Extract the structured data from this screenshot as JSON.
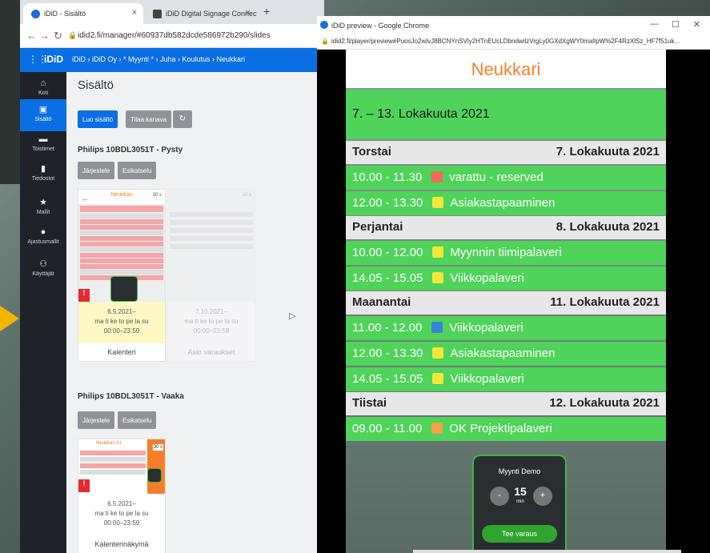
{
  "browser1": {
    "tabs": [
      {
        "label": "iDiD - Sisältö",
        "close": "×"
      },
      {
        "label": "iDiD Digital Signage Connector f",
        "close": "×"
      }
    ],
    "new_tab": "+",
    "url": "idid2.fi/manager/#60937db582dcde586972b290/slides"
  },
  "app": {
    "logo": "iDiD",
    "breadcrumb": "iDiD › iDiD Oy › * Myynti * › Juha › Koulutus › Neukkari",
    "sidebar": [
      {
        "icon": "home-icon",
        "glyph": "⌂",
        "label": "Koti"
      },
      {
        "icon": "image-icon",
        "glyph": "▣",
        "label": "Sisältö"
      },
      {
        "icon": "monitor-icon",
        "glyph": "▬",
        "label": "Toistimet"
      },
      {
        "icon": "file-icon",
        "glyph": "▮",
        "label": "Tiedostot"
      },
      {
        "icon": "star-icon",
        "glyph": "★",
        "label": "Mallit"
      },
      {
        "icon": "clock-icon",
        "glyph": "●",
        "label": "Ajastusmallit"
      },
      {
        "icon": "users-icon",
        "glyph": "⚇",
        "label": "Käyttäjät"
      }
    ],
    "page_title": "Sisältö",
    "create_button": "Luo sisältö",
    "order_channel_button": "Tilaa kanava",
    "refresh_icon": "refresh-icon",
    "sections": [
      {
        "title": "Philips 10BDL3051T - Pysty",
        "arrange_button": "Järjestele",
        "preview_button": "Esikatselu",
        "cards": [
          {
            "thumb_title": "Neukkari",
            "duration": "30 s",
            "dates": "6.5.2021–",
            "days": "ma ti ke to pe la su",
            "time": "00:00–23:59",
            "name": "Kalenteri"
          },
          {
            "thumb_title": "",
            "duration": "30 s",
            "dates": "7.10.2021–",
            "days": "ma ti ke to pe la su",
            "time": "00:00–23:59",
            "name": "Asio varaukset"
          }
        ]
      },
      {
        "title": "Philips 10BDL3051T - Vaaka",
        "arrange_button": "Järjestele",
        "preview_button": "Esikatselu",
        "cards": [
          {
            "thumb_title": "Neukkari A1",
            "duration": "30 s",
            "dates": "6.5.2021–",
            "days": "ma ti ke to pe la su",
            "time": "00:00–23:59",
            "name": "Kalenterinäkymä"
          }
        ]
      }
    ]
  },
  "browser2": {
    "title": "iDiD preview - Google Chrome",
    "url": "idid2.fi/player/preview#PuosJo2wlvJ8BCNYnSVly2HTnEUcLDbndwilzVrgLy0GXdXgWY0malIpW%2F4RzXlSz_HF7f51uk..."
  },
  "calendar": {
    "room": "Neukkari",
    "week": "7. – 13. Lokakuuta 2021",
    "days": [
      {
        "day": "Torstai",
        "date": "7. Lokakuuta 2021",
        "events": [
          {
            "time": "10.00 - 11.30",
            "title": "varattu - reserved",
            "color": "#f06b5b"
          },
          {
            "time": "12.00 - 13.30",
            "title": "Asiakastapaaminen",
            "color": "#f2e63a"
          }
        ]
      },
      {
        "day": "Perjantai",
        "date": "8. Lokakuuta 2021",
        "events": [
          {
            "time": "10.00 - 12.00",
            "title": "Myynnin tiimipalaveri",
            "color": "#f2e63a"
          },
          {
            "time": "14.05 - 15.05",
            "title": "Viikkopalaveri",
            "color": "#f2e63a"
          }
        ]
      },
      {
        "day": "Maanantai",
        "date": "11. Lokakuuta 2021",
        "events": [
          {
            "time": "11.00 - 12.00",
            "title": "Viikkopalaveri",
            "color": "#3b82d6"
          },
          {
            "time": "12.00 - 13.30",
            "title": "Asiakastapaaminen",
            "color": "#f2e63a"
          },
          {
            "time": "14.05 - 15.05",
            "title": "Viikkopalaveri",
            "color": "#f2e63a"
          }
        ]
      },
      {
        "day": "Tiistai",
        "date": "12. Lokakuuta 2021",
        "events": [
          {
            "time": "09.00 - 11.00",
            "title": "OK Projektipalaveri",
            "color": "#f5a04a"
          }
        ]
      }
    ],
    "booking": {
      "title": "Myynti Demo",
      "minus": "-",
      "plus": "+",
      "minutes": "15",
      "unit": "min",
      "button": "Tee varaus"
    }
  }
}
